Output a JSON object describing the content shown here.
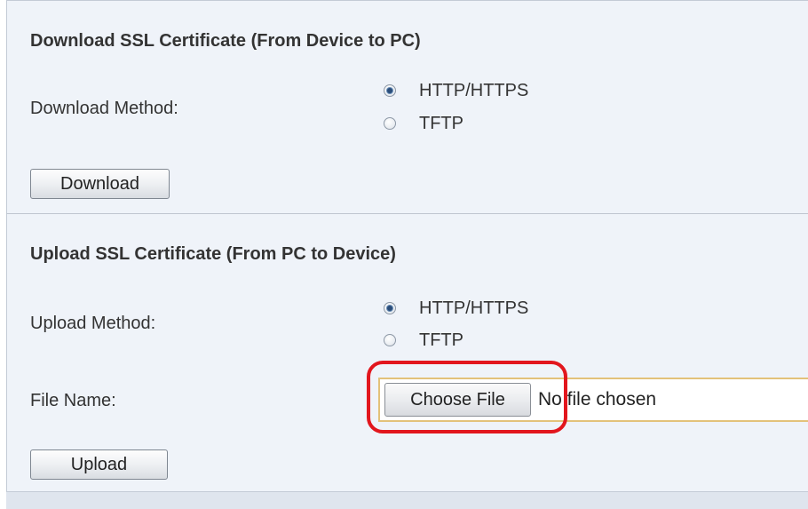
{
  "download_section": {
    "title": "Download SSL Certificate (From Device to PC)",
    "method_label": "Download Method:",
    "options": [
      {
        "label": "HTTP/HTTPS",
        "checked": true
      },
      {
        "label": "TFTP",
        "checked": false
      }
    ],
    "button_label": "Download"
  },
  "upload_section": {
    "title": "Upload SSL Certificate (From PC to Device)",
    "method_label": "Upload Method:",
    "options": [
      {
        "label": "HTTP/HTTPS",
        "checked": true
      },
      {
        "label": "TFTP",
        "checked": false
      }
    ],
    "file_name_label": "File Name:",
    "choose_file_label": "Choose File",
    "file_status": "No file chosen",
    "button_label": "Upload"
  },
  "colors": {
    "panel_background": "#eff3f9",
    "highlight_ring": "#e2161d",
    "file_field_border": "#e3c27a"
  }
}
